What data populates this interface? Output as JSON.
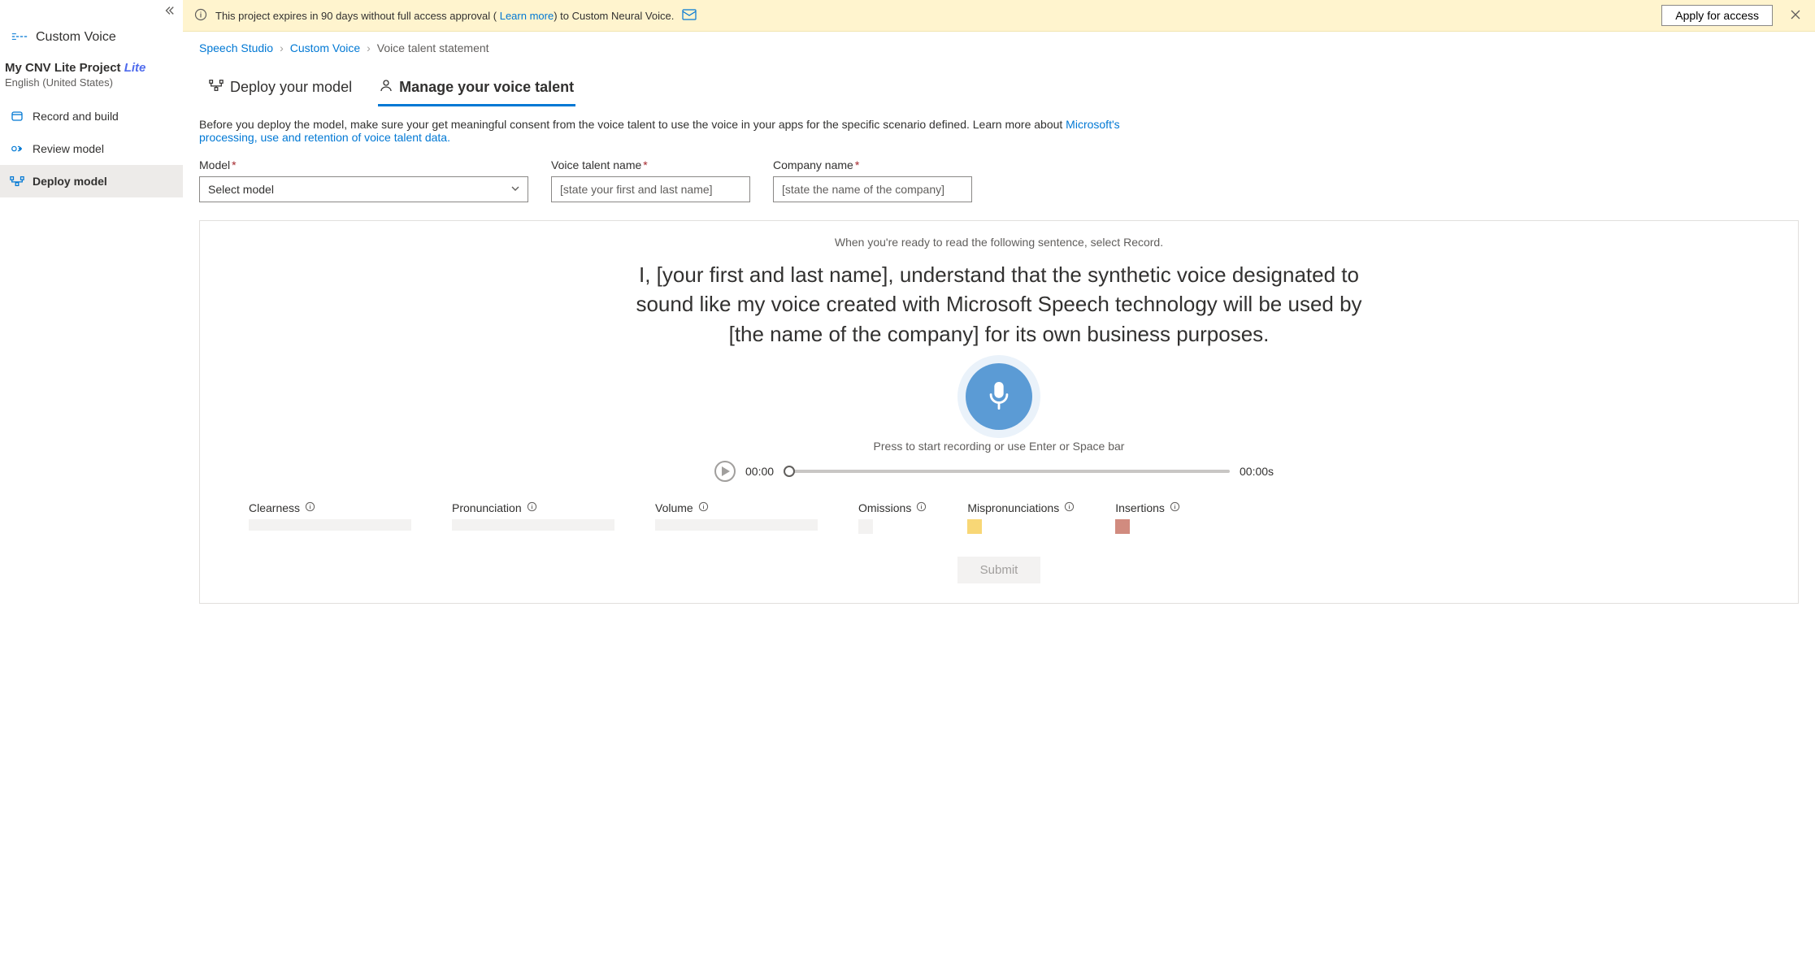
{
  "sidebar": {
    "brand": "Custom Voice",
    "project_name": "My CNV Lite Project",
    "project_badge": "Lite",
    "project_locale": "English (United States)",
    "items": [
      {
        "label": "Record and build"
      },
      {
        "label": "Review model"
      },
      {
        "label": "Deploy model"
      }
    ]
  },
  "banner": {
    "text_before": "This project expires in 90 days without full access approval ( ",
    "learn_more": "Learn more",
    "text_after": ") to Custom Neural Voice.",
    "apply": "Apply for access"
  },
  "breadcrumbs": {
    "a": "Speech Studio",
    "b": "Custom Voice",
    "c": "Voice talent statement"
  },
  "tabs": {
    "deploy": "Deploy your model",
    "manage": "Manage your voice talent"
  },
  "description": {
    "before": "Before you deploy the model, make sure your get meaningful consent from the voice talent to use the voice in your apps for the specific scenario defined. Learn more about ",
    "link": "Microsoft's processing, use and retention of voice talent data."
  },
  "form": {
    "model_label": "Model",
    "model_placeholder": "Select model",
    "voice_label": "Voice talent name",
    "voice_placeholder": "[state your first and last name]",
    "company_label": "Company name",
    "company_placeholder": "[state the name of the company]"
  },
  "card": {
    "hint": "When you're ready to read the following sentence, select Record.",
    "statement": "I, [your first and last name], understand that the synthetic voice designated to sound like my voice created with Microsoft Speech technology will be used by [the name of the company] for its own business purposes.",
    "rec_hint": "Press to start recording or use Enter or Space bar",
    "time": "00:00",
    "duration": "00:00s"
  },
  "metrics": {
    "clearness": "Clearness",
    "pronunciation": "Pronunciation",
    "volume": "Volume",
    "omissions": "Omissions",
    "mispron": "Mispronunciations",
    "insertions": "Insertions"
  },
  "submit": "Submit"
}
